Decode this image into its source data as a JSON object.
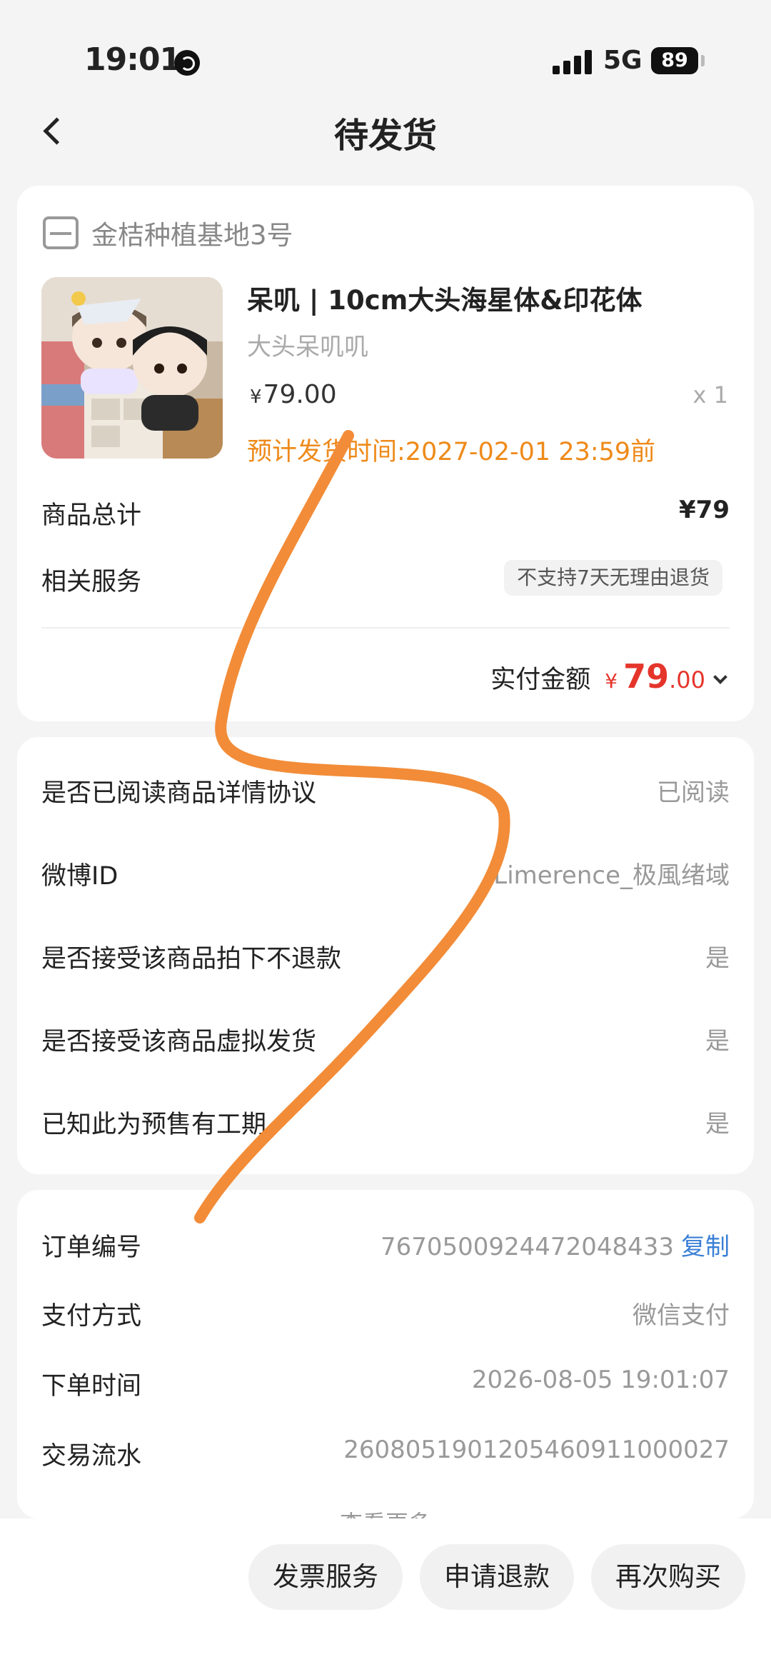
{
  "status_bar": {
    "time": "19:01",
    "network": "5G",
    "battery": "89"
  },
  "nav": {
    "title": "待发货"
  },
  "order_card": {
    "shop_name": "金桔种植基地3号",
    "product": {
      "title": "呆叽 | 10cm大头海星体&印花体",
      "subtitle": "大头呆叽叽",
      "currency": "¥",
      "price": "79.00",
      "quantity": "x 1",
      "ship_time": "预计发货时间:2027-02-01 23:59前"
    },
    "goods_total_label": "商品总计",
    "goods_total_value": "¥79",
    "service_label": "相关服务",
    "service_badge": "不支持7天无理由退货",
    "paid_label": "实付金额",
    "paid_currency": "¥",
    "paid_int": "79",
    "paid_dec": ".00"
  },
  "questions": [
    {
      "label": "是否已阅读商品详情协议",
      "value": "已阅读"
    },
    {
      "label": "微博ID",
      "value": "Limerence_极風绪域"
    },
    {
      "label": "是否接受该商品拍下不退款",
      "value": "是"
    },
    {
      "label": "是否接受该商品虚拟发货",
      "value": "是"
    },
    {
      "label": "已知此为预售有工期",
      "value": "是"
    }
  ],
  "order_info": {
    "order_no_label": "订单编号",
    "order_no": "7670500924472048433",
    "copy_label": "复制",
    "payment_label": "支付方式",
    "payment_value": "微信支付",
    "order_time_label": "下单时间",
    "order_time": "2026-08-05 19:01:07",
    "txn_label": "交易流水",
    "txn_value": "2608051901205460911000027",
    "more_label": "查看更多"
  },
  "actions": {
    "invoice": "发票服务",
    "refund": "申请退款",
    "rebuy": "再次购买"
  },
  "colors": {
    "accent_orange": "#ee8a1a",
    "price_red": "#e5352b",
    "link_blue": "#3a7fd6",
    "scribble": "#f28c38"
  }
}
